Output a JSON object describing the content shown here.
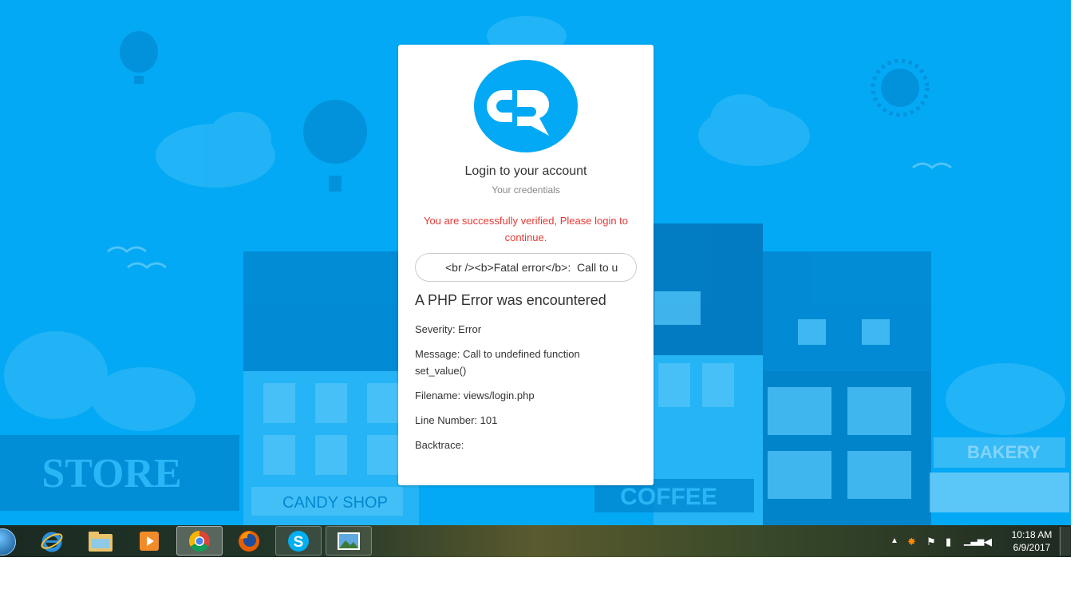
{
  "login": {
    "title": "Login to your account",
    "subtitle": "Your credentials",
    "notice": "You are successfully verified, Please login to continue.",
    "input_value": "<br /><b>Fatal error</b>:  Call to u"
  },
  "php_error": {
    "heading": "A PHP Error was encountered",
    "severity": "Severity: Error",
    "message": "Message: Call to undefined function set_value()",
    "filename": "Filename: views/login.php",
    "line": "Line Number: 101",
    "backtrace": "Backtrace:"
  },
  "background": {
    "store_sign": "STORE",
    "candy_sign": "CANDY SHOP",
    "coffee_sign": "COFFEE",
    "bakery_sign": "BAKERY"
  },
  "taskbar": {
    "apps": [
      {
        "icon": "internet-explorer-icon"
      },
      {
        "icon": "file-explorer-icon"
      },
      {
        "icon": "media-player-icon"
      },
      {
        "icon": "chrome-icon"
      },
      {
        "icon": "firefox-icon"
      },
      {
        "icon": "skype-icon"
      },
      {
        "icon": "photo-viewer-icon"
      }
    ],
    "clock_time": "10:18 AM",
    "clock_date": "6/9/2017"
  },
  "colors": {
    "background": "#03a9f4",
    "notice": "#e53935"
  }
}
